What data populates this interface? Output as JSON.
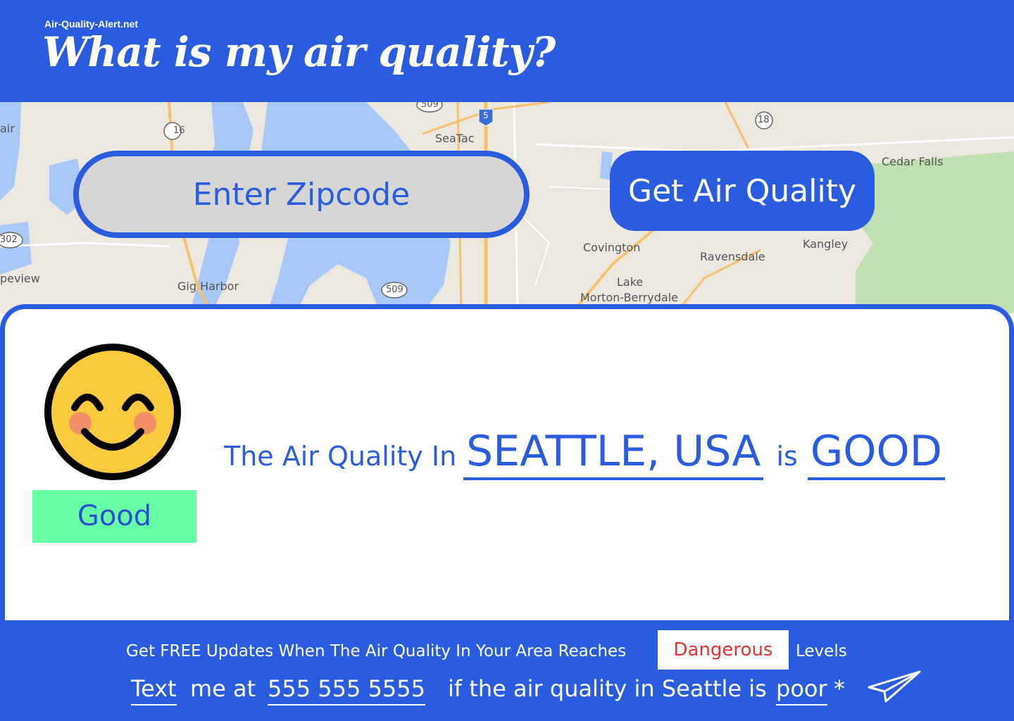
{
  "header": {
    "site_name": "Air-Quality-Alert.net",
    "headline": "What is my air quality?"
  },
  "map": {
    "labels": {
      "seatac": "SeaTac",
      "gig_harbor": "Gig Harbor",
      "covington": "Covington",
      "ravensdale": "Ravensdale",
      "kangley": "Kangley",
      "lake_morton": "Lake",
      "lake_morton_2": "Morton-Berrydale",
      "cedar_falls": "Cedar Falls",
      "air": "air",
      "peview": "peview",
      "route_16": "16",
      "route_18": "18",
      "route_302": "302",
      "route_509_top": "509",
      "route_509": "509",
      "route_5": "5"
    }
  },
  "search": {
    "placeholder": "Enter Zipcode",
    "button_label": "Get Air Quality"
  },
  "result": {
    "status_label": "Good",
    "sentence_prefix": "The Air Quality In",
    "city": "SEATTLE, USA",
    "is_word": "is",
    "level": "GOOD",
    "emoji_icon": "smiling-face-icon"
  },
  "footer": {
    "promo_prefix": "Get FREE Updates When The Air Quality In Your Area Reaches",
    "danger_label": "Dangerous",
    "promo_suffix": "Levels",
    "cta_text": "Text",
    "cta_me_at": "me at",
    "phone": "555 555 5555",
    "cta_middle": "if the air quality in Seattle is",
    "cta_poor": "poor",
    "cta_star": "*",
    "send_icon": "paper-plane-icon"
  },
  "colors": {
    "brand_blue": "#2a5ce0",
    "good_green": "#66ffa6",
    "danger_red": "#e8322b"
  }
}
